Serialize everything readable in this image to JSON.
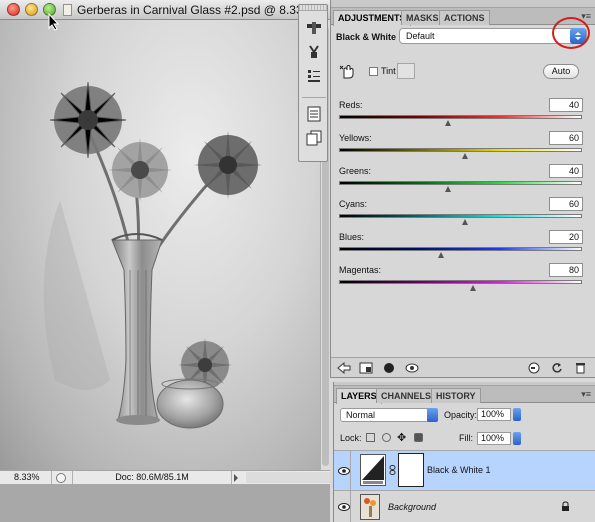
{
  "document": {
    "title": "Gerberas in Carnival Glass #2.psd @ 8.33",
    "zoom": "8.33%",
    "doc_size": "Doc: 80.6M/85.1M"
  },
  "adjustments": {
    "tabs": [
      "ADJUSTMENTS",
      "MASKS",
      "ACTIONS"
    ],
    "panel_menu": "▾≡",
    "adjustment_name": "Black & White",
    "preset": "Default",
    "tint_label": "Tint",
    "auto_label": "Auto",
    "channels": [
      {
        "label": "Reds:",
        "value": "40",
        "fraction": 0.45,
        "gradient": "linear-gradient(90deg,#000,#7a0000,#ff2a2a,#ffffff)"
      },
      {
        "label": "Yellows:",
        "value": "60",
        "fraction": 0.52,
        "gradient": "linear-gradient(90deg,#000,#6e6a00,#e8e000,#ffffff)"
      },
      {
        "label": "Greens:",
        "value": "40",
        "fraction": 0.45,
        "gradient": "linear-gradient(90deg,#000,#006a10,#22e040,#ffffff)"
      },
      {
        "label": "Cyans:",
        "value": "60",
        "fraction": 0.52,
        "gradient": "linear-gradient(90deg,#000,#006a6a,#19e4e4,#ffffff)"
      },
      {
        "label": "Blues:",
        "value": "20",
        "fraction": 0.42,
        "gradient": "linear-gradient(90deg,#000,#00106e,#1a3cff,#ffffff)"
      },
      {
        "label": "Magentas:",
        "value": "80",
        "fraction": 0.55,
        "gradient": "linear-gradient(90deg,#000,#6a006a,#e21ae2,#ffffff)"
      }
    ]
  },
  "layers": {
    "tabs": [
      "LAYERS",
      "CHANNELS",
      "HISTORY"
    ],
    "blend_mode": "Normal",
    "opacity_label": "Opacity:",
    "opacity": "100%",
    "lock_label": "Lock:",
    "fill_label": "Fill:",
    "fill": "100%",
    "items": [
      {
        "name": "Black & White 1",
        "selected": true
      },
      {
        "name": "Background",
        "selected": false
      }
    ]
  },
  "icons": {
    "traffic_lights": [
      "close-icon",
      "minimize-icon",
      "zoom-icon"
    ],
    "toolstrip": [
      "adjustments-icon",
      "styles-icon",
      "layer-comps-icon",
      "notes-icon",
      "clone-icon"
    ],
    "adjust_bottom": [
      "back-icon",
      "clip-icon",
      "mask-icon",
      "visibility-icon",
      "reset-icon",
      "delete-icon"
    ]
  },
  "colors": {
    "selection_highlight": "#b7d4ff",
    "annotation_circle": "#d41e1e",
    "select_button": "#2b63c9"
  }
}
